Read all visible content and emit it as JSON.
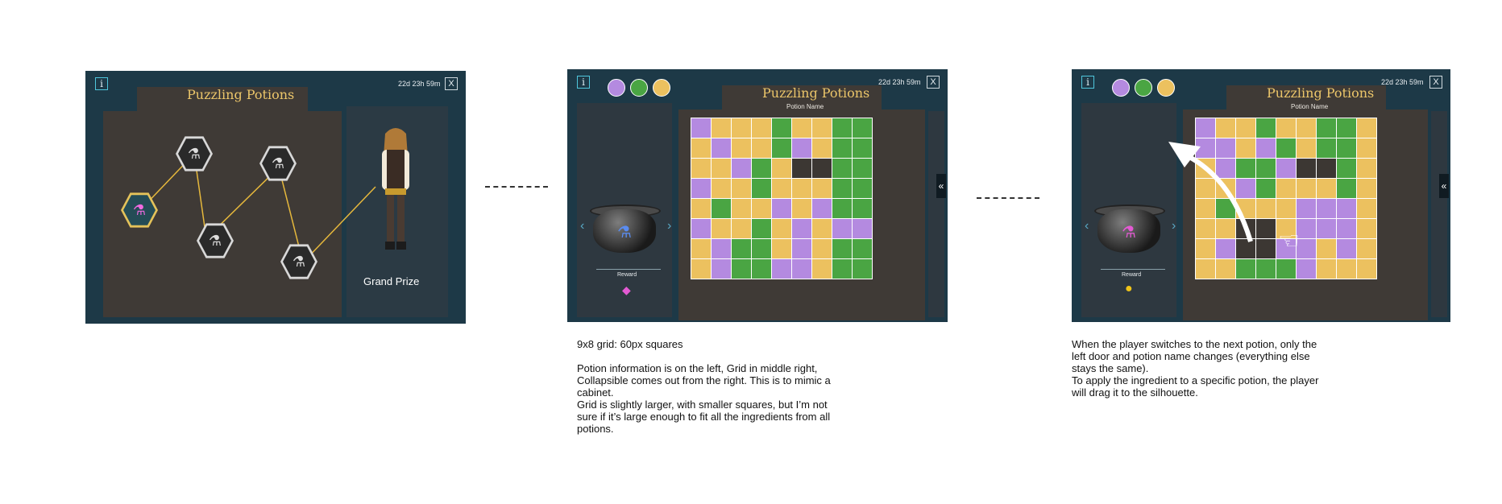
{
  "panel1": {
    "info": "i",
    "timer": "22d 23h 59m",
    "close": "X",
    "title": "Puzzling Potions",
    "grand_prize": "Grand Prize"
  },
  "panel2": {
    "info": "i",
    "timer": "22d 23h 59m",
    "close": "X",
    "title": "Puzzling Potions",
    "potion_name": "Potion Name",
    "reward": "Reward",
    "collapse": "«",
    "ingredient_colors": [
      "#b48ae0",
      "#4aa543",
      "#ecc15f"
    ],
    "grid": [
      "pyyygyygg",
      "ypyygpygg",
      "yypgyddgg",
      "pyygyyygg",
      "ygyypypgg",
      "pyygypypp",
      "ypggypygg",
      "ypggppygg"
    ]
  },
  "panel3": {
    "info": "i",
    "timer": "22d 23h 59m",
    "close": "X",
    "title": "Puzzling Potions",
    "potion_name": "Potion Name",
    "reward": "Reward",
    "collapse": "«",
    "ingredient_colors": [
      "#b48ae0",
      "#4aa543",
      "#ecc15f"
    ],
    "grid": [
      "pyygyygg",
      "ppypgygg",
      "ypggpddg",
      "yypgyyyg",
      "ygyyyppp",
      "yyddyppp",
      "ypddppyp",
      "yygggpyyy"
    ]
  },
  "notes": {
    "note1": "9x8 grid: 60px squares\n\nPotion information is on the left, Grid in middle right,\nCollapsible comes out from the right. This is to mimic a\ncabinet.\nGrid is slightly larger, with smaller squares, but I’m not\nsure if it’s large enough to fit all the ingredients from all\npotions.",
    "note2": "When the player switches to the next potion, only the\nleft door and potion name changes (everything else\nstays the same).\nTo apply the ingredient to a specific potion, the player\nwill drag it to the silhouette."
  }
}
